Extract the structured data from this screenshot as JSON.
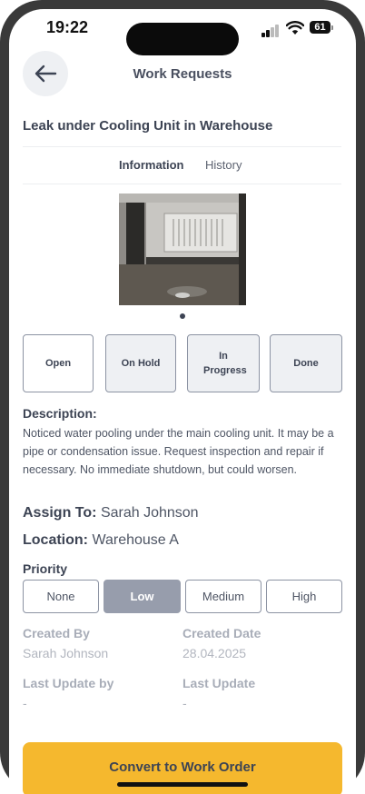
{
  "status_bar": {
    "time": "19:22",
    "battery": "61"
  },
  "header": {
    "title": "Work Requests"
  },
  "request": {
    "title": "Leak under Cooling Unit in Warehouse"
  },
  "tabs": [
    {
      "label": "Information",
      "active": true
    },
    {
      "label": "History",
      "active": false
    }
  ],
  "status_options": [
    {
      "label": "Open",
      "active": true
    },
    {
      "label": "On Hold",
      "active": false
    },
    {
      "label": "In Progress",
      "active": false
    },
    {
      "label": "Done",
      "active": false
    }
  ],
  "description": {
    "label": "Description:",
    "text": "Noticed water pooling under the main cooling unit. It may be a pipe or condensation issue. Request inspection and repair if necessary. No immediate shutdown, but could worsen."
  },
  "assign": {
    "label": "Assign To:",
    "value": "Sarah Johnson"
  },
  "location": {
    "label": "Location:",
    "value": "Warehouse A"
  },
  "priority": {
    "label": "Priority",
    "options": [
      "None",
      "Low",
      "Medium",
      "High"
    ],
    "selected": "Low"
  },
  "meta": {
    "created_by_label": "Created By",
    "created_by": "Sarah Johnson",
    "created_date_label": "Created Date",
    "created_date": "28.04.2025",
    "last_update_by_label": "Last Update by",
    "last_update_by": "-",
    "last_update_label": "Last Update",
    "last_update": "-"
  },
  "actions": {
    "convert_label": "Convert to Work Order"
  },
  "icons": {
    "back": "arrow-left-icon",
    "wifi": "wifi-icon",
    "signal": "cellular-signal-icon",
    "battery": "battery-icon"
  },
  "colors": {
    "accent": "#f5b82e",
    "selected_priority": "#979dac",
    "text": "#3d4454"
  }
}
